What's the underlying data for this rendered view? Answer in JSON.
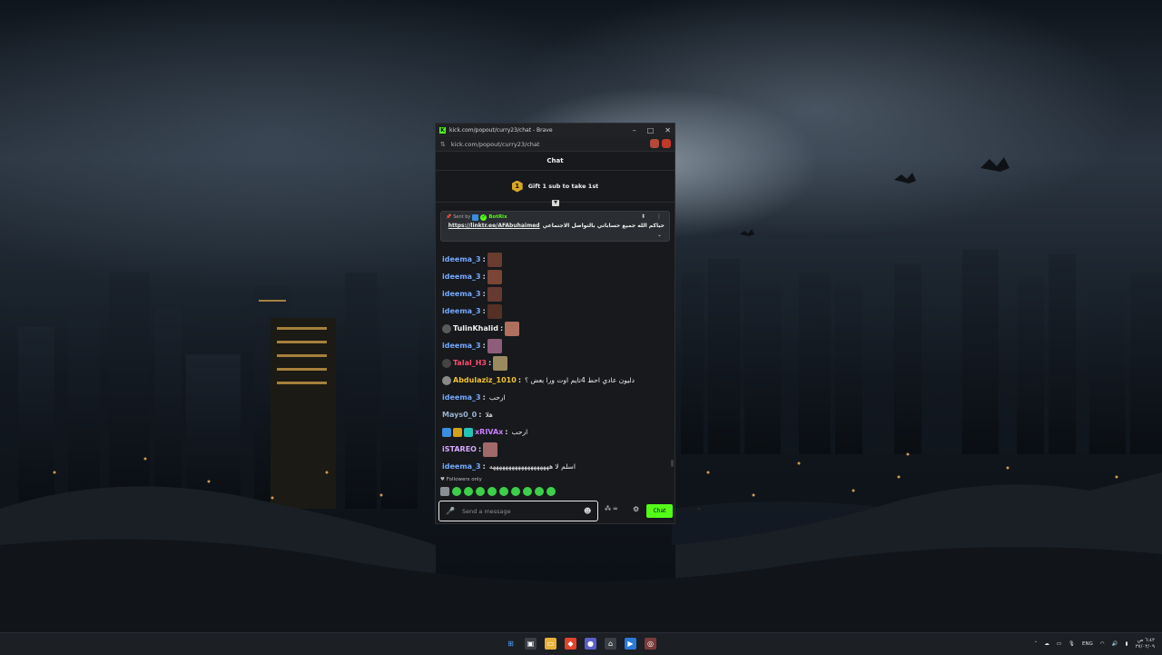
{
  "browser": {
    "window_title": "kick.com/popout/curry23/chat - Brave",
    "url": "kick.com/popout/curry23/chat"
  },
  "chat": {
    "header_title": "Chat",
    "gift_banner": {
      "badge_number": "1",
      "text": "Gift 1 sub to take 1st"
    },
    "pinned": {
      "sent_by_label": "Sent by",
      "bot_name": "BotRix",
      "message_text": "حياكم الله جميع حساباتي بالتواصل الاجتماعي",
      "link": "https://linktr.ee/AFAbuhaimed"
    },
    "messages": [
      {
        "username": "ideema_3",
        "color": "#74a8ff",
        "text": "",
        "emotes": [
          "#6a3b2f"
        ],
        "badges": []
      },
      {
        "username": "ideema_3",
        "color": "#74a8ff",
        "text": "",
        "emotes": [
          "#7a4536"
        ],
        "badges": []
      },
      {
        "username": "ideema_3",
        "color": "#74a8ff",
        "text": "",
        "emotes": [
          "#653a30"
        ],
        "badges": []
      },
      {
        "username": "ideema_3",
        "color": "#74a8ff",
        "text": "",
        "emotes": [
          "#553025"
        ],
        "badges": []
      },
      {
        "username": "TulinKhalid",
        "color": "#f2f2f2",
        "text": "",
        "emotes": [
          "#b07060"
        ],
        "badges": [
          "#5a5a5a"
        ]
      },
      {
        "username": "ideema_3",
        "color": "#74a8ff",
        "text": "",
        "emotes": [
          "#8e5d7a"
        ],
        "badges": []
      },
      {
        "username": "Talal_H3",
        "color": "#ff4b6e",
        "text": "",
        "emotes": [
          "#9a8a60"
        ],
        "badges": [
          "#444444"
        ]
      },
      {
        "username": "Abdulaziz_1010",
        "color": "#f1c232",
        "text": "دليون عادي احط 4تايم اوت ورا بعض ؟",
        "emotes": [],
        "badges": [
          "#8a8a8a"
        ]
      },
      {
        "username": "ideema_3",
        "color": "#74a8ff",
        "text": "ارحب",
        "emotes": [],
        "badges": []
      },
      {
        "username": "Mays0_0",
        "color": "#9bb3d0",
        "text": "هلا",
        "emotes": [],
        "badges": []
      },
      {
        "username": "xRIVAx",
        "color": "#c77dff",
        "text": "ارحب",
        "emotes": [],
        "badges": [
          "#3a8ddf",
          "#d4a017",
          "#22c3b8"
        ]
      },
      {
        "username": "iSTAREO",
        "color": "#d6a7ff",
        "text": "",
        "emotes": [
          "#a06a6a"
        ],
        "badges": []
      },
      {
        "username": "ideema_3",
        "color": "#74a8ff",
        "text": "اسلم لا هههههههههههههههههههه",
        "emotes": [],
        "badges": []
      }
    ],
    "followers_only_label": "Followers only",
    "input_placeholder": "Send a message",
    "points_label": "∞",
    "send_button_label": "Chat"
  },
  "taskbar": {
    "language": "ENG",
    "time": "٦:٤٢ ص",
    "date": "٢٧/٠٢/٠٩"
  },
  "colors": {
    "kick_green": "#53fc18",
    "popup_bg": "#17191c",
    "gift_gold": "#d9a622"
  }
}
